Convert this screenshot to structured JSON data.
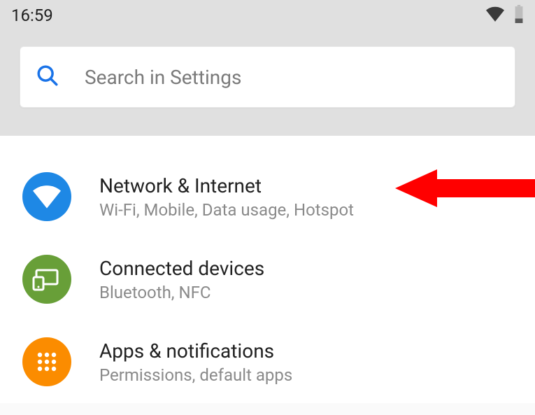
{
  "status": {
    "time": "16:59",
    "wifi_icon": "wifi-icon",
    "battery_icon": "battery-icon"
  },
  "search": {
    "placeholder": "Search in Settings",
    "icon": "search-icon"
  },
  "items": [
    {
      "title": "Network & Internet",
      "subtitle": "Wi-Fi, Mobile, Data usage, Hotspot",
      "icon_bg": "#1e88e5",
      "icon": "wifi-solid-icon"
    },
    {
      "title": "Connected devices",
      "subtitle": "Bluetooth, NFC",
      "icon_bg": "#689f38",
      "icon": "connected-devices-icon"
    },
    {
      "title": "Apps & notifications",
      "subtitle": "Permissions, default apps",
      "icon_bg": "#fb8c00",
      "icon": "apps-grid-icon"
    }
  ],
  "annotation": {
    "arrow_color": "#ff0000"
  }
}
